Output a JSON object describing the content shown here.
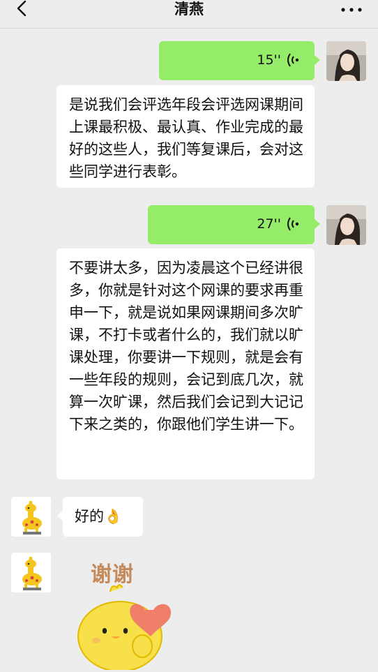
{
  "header": {
    "title": "清燕"
  },
  "messages": {
    "voice1": {
      "duration": "15''"
    },
    "text1": {
      "text": "是说我们会评选年段会评选网课期间上课最积极、最认真、作业完成的最好的这些人，我们等复课后，会对这些同学进行表彰。"
    },
    "voice2": {
      "duration": "27''"
    },
    "text2": {
      "text": "不要讲太多，因为凌晨这个已经讲很多，你就是针对这个网课的要求再重申一下，就是说如果网课期间多次旷课，不打卡或者什么的，我们就以旷课处理，你要讲一下规则，就是会有一些年段的规则，会记到底几次，就算一次旷课，然后我们会记到大记记下来之类的，你跟他们学生讲一下。"
    },
    "reply1": {
      "text": "好的👌"
    },
    "sticker": {
      "caption": "谢谢"
    }
  },
  "colors": {
    "sent_bubble": "#95ec69",
    "received_bubble": "#ffffff",
    "background": "#ededed"
  }
}
